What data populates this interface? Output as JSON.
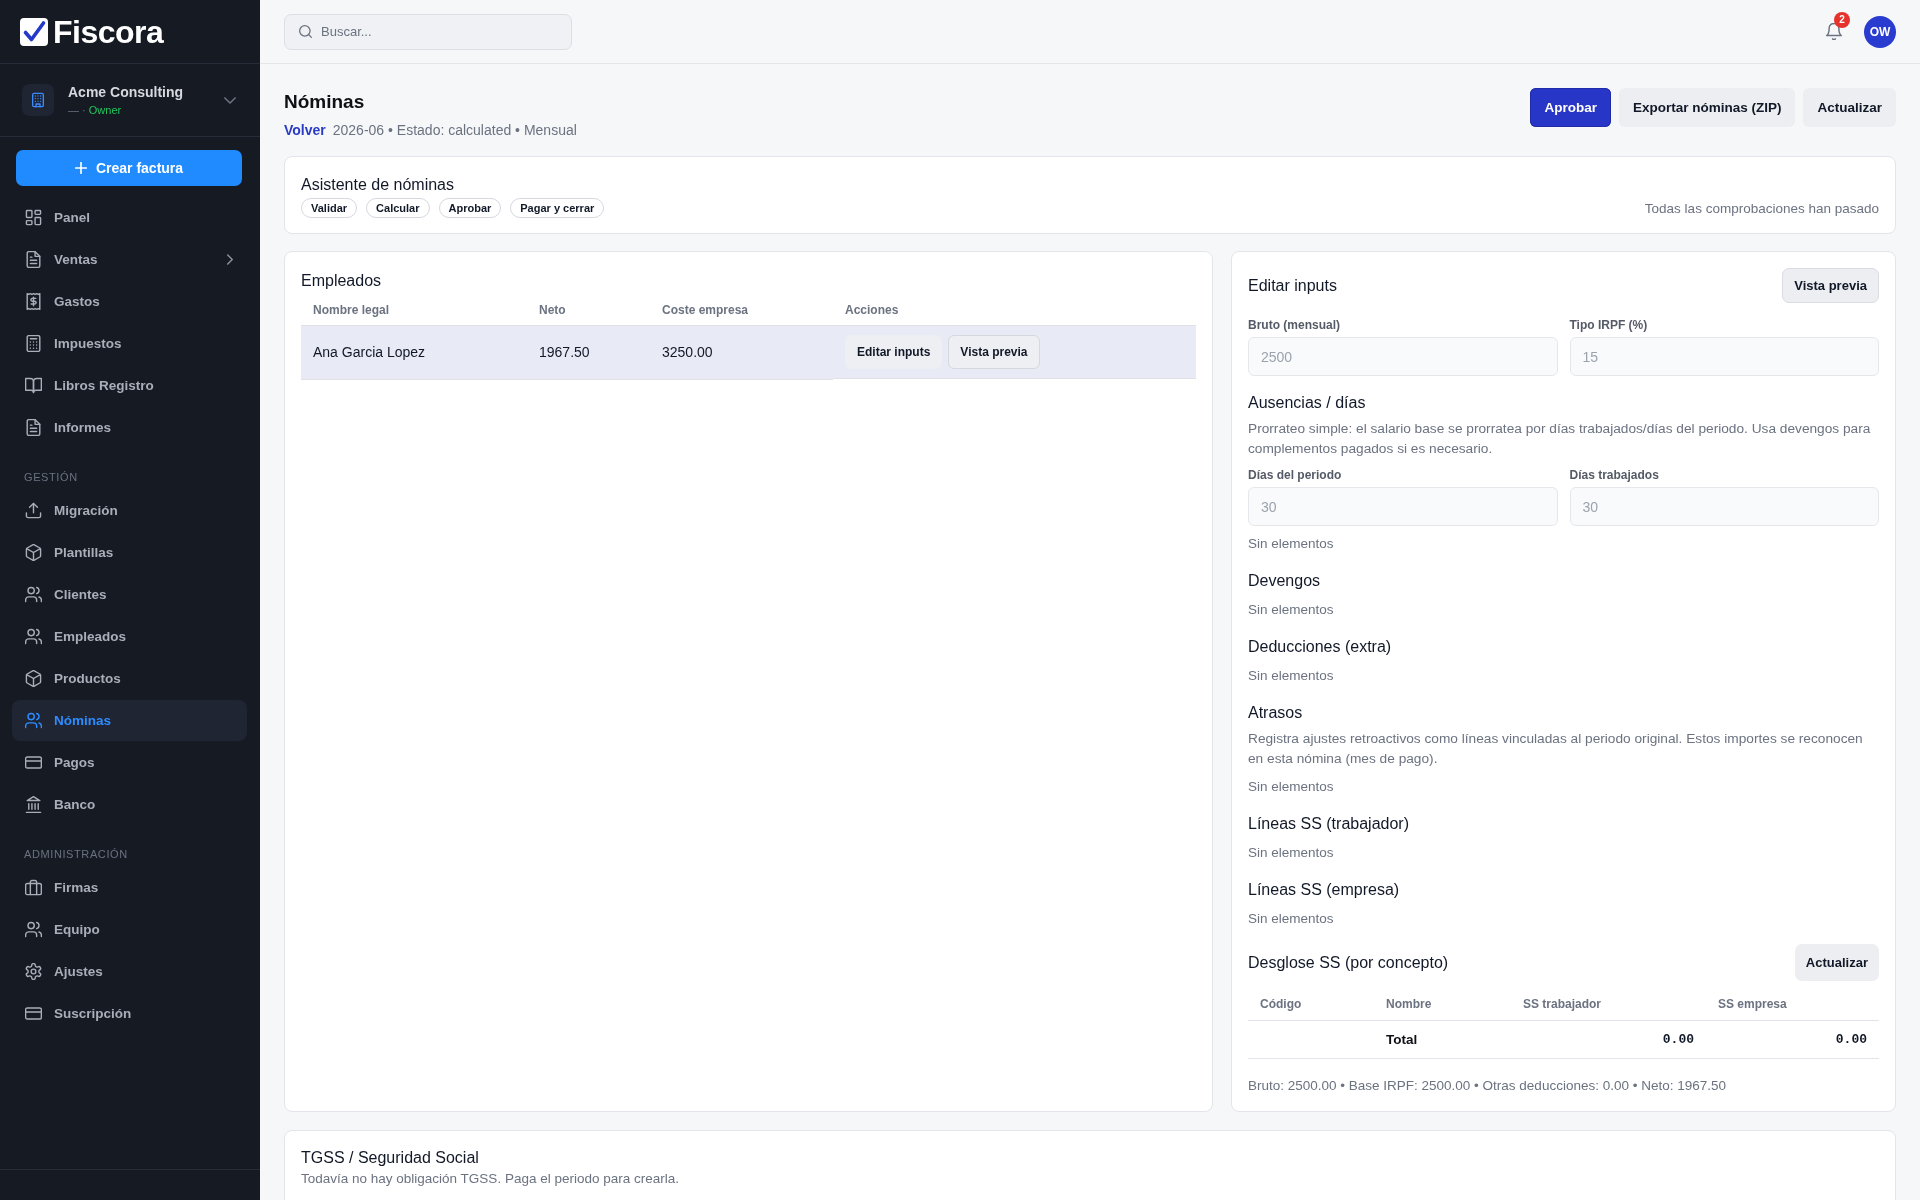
{
  "sidebar": {
    "logo": "Fiscora",
    "organization": {
      "name": "Acme Consulting",
      "meta": "— ·",
      "role": "Owner"
    },
    "create_button": "Crear factura",
    "sections": [
      {
        "items": [
          {
            "label": "Panel",
            "selected": false,
            "submenu": false
          },
          {
            "label": "Ventas",
            "selected": false,
            "submenu": true
          },
          {
            "label": "Gastos",
            "selected": false,
            "submenu": false
          },
          {
            "label": "Impuestos",
            "selected": false,
            "submenu": false
          },
          {
            "label": "Libros Registro",
            "selected": false,
            "submenu": false
          },
          {
            "label": "Informes",
            "selected": false,
            "submenu": false
          }
        ]
      },
      {
        "heading": "GESTIÓN",
        "items": [
          {
            "label": "Migración",
            "selected": false,
            "submenu": false
          },
          {
            "label": "Plantillas",
            "selected": false,
            "submenu": false
          },
          {
            "label": "Clientes",
            "selected": false,
            "submenu": false
          },
          {
            "label": "Empleados",
            "selected": false,
            "submenu": false
          },
          {
            "label": "Productos",
            "selected": false,
            "submenu": false
          },
          {
            "label": "Nóminas",
            "selected": true,
            "submenu": false
          },
          {
            "label": "Pagos",
            "selected": false,
            "submenu": false
          },
          {
            "label": "Banco",
            "selected": false,
            "submenu": false
          }
        ]
      },
      {
        "heading": "ADMINISTRACIÓN",
        "items": [
          {
            "label": "Firmas",
            "selected": false,
            "submenu": false
          },
          {
            "label": "Equipo",
            "selected": false,
            "submenu": false
          },
          {
            "label": "Ajustes",
            "selected": false,
            "submenu": false
          },
          {
            "label": "Suscripción",
            "selected": false,
            "submenu": false
          }
        ]
      }
    ]
  },
  "top_bar": {
    "search": {
      "placeholder": "Buscar..."
    },
    "notifications": {
      "count": "2"
    },
    "avatar": {
      "initials": "OW"
    }
  },
  "page_header": {
    "title": "Nóminas",
    "back_link": "Volver",
    "meta": "2026-06 • Estado: calculated • Mensual",
    "actions": [
      {
        "label": "Aprobar",
        "kind": "primary"
      },
      {
        "label": "Exportar nóminas (ZIP)",
        "kind": "secondary"
      },
      {
        "label": "Actualizar",
        "kind": "secondary"
      }
    ]
  },
  "wizard": {
    "title": "Asistente de nóminas",
    "steps": [
      "Validar",
      "Calcular",
      "Aprobar",
      "Pagar y cerrar"
    ],
    "status": "Todas las comprobaciones han pasado"
  },
  "employees": {
    "title": "Empleados",
    "columns": [
      "Nombre legal",
      "Neto",
      "Coste empresa",
      "Acciones"
    ],
    "rows": [
      {
        "name": "Ana Garcia Lopez",
        "net": "1967.50",
        "employer_cost": "3250.00",
        "selected": true,
        "actions": [
          {
            "label": "Editar inputs",
            "kind": "plain"
          },
          {
            "label": "Vista previa",
            "kind": "outlined"
          }
        ]
      }
    ]
  },
  "editor": {
    "title": "Editar inputs",
    "preview_button": "Vista previa",
    "fields": [
      {
        "label": "Bruto (mensual)",
        "value": "2500",
        "disabled": true
      },
      {
        "label": "Tipo IRPF (%)",
        "value": "15",
        "disabled": true
      }
    ],
    "sections": [
      {
        "title": "Ausencias / días",
        "description": "Prorrateo simple: el salario base se prorratea por días trabajados/días del periodo. Usa devengos para complementos pagados si es necesario.",
        "fields": [
          {
            "label": "Días del periodo",
            "value": "30",
            "disabled": true
          },
          {
            "label": "Días trabajados",
            "value": "30",
            "disabled": true
          }
        ],
        "empty_text": "Sin elementos"
      },
      {
        "title": "Devengos",
        "empty_text": "Sin elementos"
      },
      {
        "title": "Deducciones (extra)",
        "empty_text": "Sin elementos"
      },
      {
        "title": "Atrasos",
        "description": "Registra ajustes retroactivos como líneas vinculadas al periodo original. Estos importes se reconocen en esta nómina (mes de pago).",
        "empty_text": "Sin elementos"
      },
      {
        "title": "Líneas SS (trabajador)",
        "empty_text": "Sin elementos"
      },
      {
        "title": "Líneas SS (empresa)",
        "empty_text": "Sin elementos"
      }
    ],
    "ss_breakdown": {
      "title": "Desglose SS (por concepto)",
      "button": "Actualizar",
      "columns": [
        "Código",
        "Nombre",
        "SS trabajador",
        "SS empresa"
      ],
      "total": {
        "label": "Total",
        "ss_worker": "0.00",
        "ss_company": "0.00"
      }
    },
    "summary": "Bruto: 2500.00 • Base IRPF: 2500.00 • Otras deducciones: 0.00 • Neto: 1967.50"
  },
  "tgss": {
    "title": "TGSS / Seguridad Social",
    "text": "Todavía no hay obligación TGSS. Paga el periodo para crearla."
  }
}
